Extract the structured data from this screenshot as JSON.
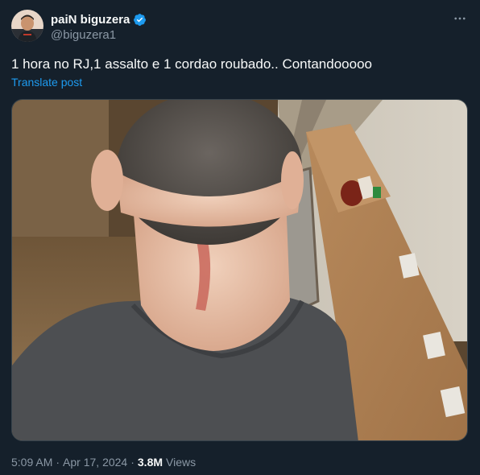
{
  "author": {
    "display_name": "paiN biguzera",
    "handle": "@biguzera1",
    "verified_icon": "verified-badge-icon",
    "verified_color": "#1d9bf0",
    "avatar_icon": "avatar"
  },
  "more_icon": "more-options-icon",
  "tweet": {
    "text": "1 hora no RJ,1 assalto e 1 cordao roubado.. Contandooooo",
    "translate_label": "Translate post",
    "photo_icon": "attached-photo"
  },
  "meta": {
    "time": "5:09 AM",
    "separator": "·",
    "date": "Apr 17, 2024",
    "views_count": "3.8M",
    "views_label": "Views"
  },
  "colors": {
    "background": "#15202b",
    "text_primary": "#f7f9f9",
    "text_secondary": "#8b98a5",
    "link": "#1d9bf0",
    "border": "#38444d"
  }
}
